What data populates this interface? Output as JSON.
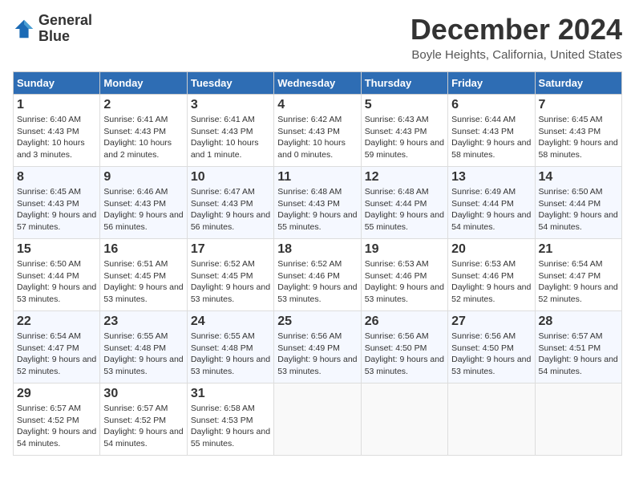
{
  "logo": {
    "line1": "General",
    "line2": "Blue"
  },
  "title": "December 2024",
  "location": "Boyle Heights, California, United States",
  "header_color": "#2e6db4",
  "days_of_week": [
    "Sunday",
    "Monday",
    "Tuesday",
    "Wednesday",
    "Thursday",
    "Friday",
    "Saturday"
  ],
  "weeks": [
    [
      {
        "day": "1",
        "sunrise": "6:40 AM",
        "sunset": "4:43 PM",
        "daylight": "10 hours and 3 minutes."
      },
      {
        "day": "2",
        "sunrise": "6:41 AM",
        "sunset": "4:43 PM",
        "daylight": "10 hours and 2 minutes."
      },
      {
        "day": "3",
        "sunrise": "6:41 AM",
        "sunset": "4:43 PM",
        "daylight": "10 hours and 1 minute."
      },
      {
        "day": "4",
        "sunrise": "6:42 AM",
        "sunset": "4:43 PM",
        "daylight": "10 hours and 0 minutes."
      },
      {
        "day": "5",
        "sunrise": "6:43 AM",
        "sunset": "4:43 PM",
        "daylight": "9 hours and 59 minutes."
      },
      {
        "day": "6",
        "sunrise": "6:44 AM",
        "sunset": "4:43 PM",
        "daylight": "9 hours and 58 minutes."
      },
      {
        "day": "7",
        "sunrise": "6:45 AM",
        "sunset": "4:43 PM",
        "daylight": "9 hours and 58 minutes."
      }
    ],
    [
      {
        "day": "8",
        "sunrise": "6:45 AM",
        "sunset": "4:43 PM",
        "daylight": "9 hours and 57 minutes."
      },
      {
        "day": "9",
        "sunrise": "6:46 AM",
        "sunset": "4:43 PM",
        "daylight": "9 hours and 56 minutes."
      },
      {
        "day": "10",
        "sunrise": "6:47 AM",
        "sunset": "4:43 PM",
        "daylight": "9 hours and 56 minutes."
      },
      {
        "day": "11",
        "sunrise": "6:48 AM",
        "sunset": "4:43 PM",
        "daylight": "9 hours and 55 minutes."
      },
      {
        "day": "12",
        "sunrise": "6:48 AM",
        "sunset": "4:44 PM",
        "daylight": "9 hours and 55 minutes."
      },
      {
        "day": "13",
        "sunrise": "6:49 AM",
        "sunset": "4:44 PM",
        "daylight": "9 hours and 54 minutes."
      },
      {
        "day": "14",
        "sunrise": "6:50 AM",
        "sunset": "4:44 PM",
        "daylight": "9 hours and 54 minutes."
      }
    ],
    [
      {
        "day": "15",
        "sunrise": "6:50 AM",
        "sunset": "4:44 PM",
        "daylight": "9 hours and 53 minutes."
      },
      {
        "day": "16",
        "sunrise": "6:51 AM",
        "sunset": "4:45 PM",
        "daylight": "9 hours and 53 minutes."
      },
      {
        "day": "17",
        "sunrise": "6:52 AM",
        "sunset": "4:45 PM",
        "daylight": "9 hours and 53 minutes."
      },
      {
        "day": "18",
        "sunrise": "6:52 AM",
        "sunset": "4:46 PM",
        "daylight": "9 hours and 53 minutes."
      },
      {
        "day": "19",
        "sunrise": "6:53 AM",
        "sunset": "4:46 PM",
        "daylight": "9 hours and 53 minutes."
      },
      {
        "day": "20",
        "sunrise": "6:53 AM",
        "sunset": "4:46 PM",
        "daylight": "9 hours and 52 minutes."
      },
      {
        "day": "21",
        "sunrise": "6:54 AM",
        "sunset": "4:47 PM",
        "daylight": "9 hours and 52 minutes."
      }
    ],
    [
      {
        "day": "22",
        "sunrise": "6:54 AM",
        "sunset": "4:47 PM",
        "daylight": "9 hours and 52 minutes."
      },
      {
        "day": "23",
        "sunrise": "6:55 AM",
        "sunset": "4:48 PM",
        "daylight": "9 hours and 53 minutes."
      },
      {
        "day": "24",
        "sunrise": "6:55 AM",
        "sunset": "4:48 PM",
        "daylight": "9 hours and 53 minutes."
      },
      {
        "day": "25",
        "sunrise": "6:56 AM",
        "sunset": "4:49 PM",
        "daylight": "9 hours and 53 minutes."
      },
      {
        "day": "26",
        "sunrise": "6:56 AM",
        "sunset": "4:50 PM",
        "daylight": "9 hours and 53 minutes."
      },
      {
        "day": "27",
        "sunrise": "6:56 AM",
        "sunset": "4:50 PM",
        "daylight": "9 hours and 53 minutes."
      },
      {
        "day": "28",
        "sunrise": "6:57 AM",
        "sunset": "4:51 PM",
        "daylight": "9 hours and 54 minutes."
      }
    ],
    [
      {
        "day": "29",
        "sunrise": "6:57 AM",
        "sunset": "4:52 PM",
        "daylight": "9 hours and 54 minutes."
      },
      {
        "day": "30",
        "sunrise": "6:57 AM",
        "sunset": "4:52 PM",
        "daylight": "9 hours and 54 minutes."
      },
      {
        "day": "31",
        "sunrise": "6:58 AM",
        "sunset": "4:53 PM",
        "daylight": "9 hours and 55 minutes."
      },
      null,
      null,
      null,
      null
    ]
  ]
}
